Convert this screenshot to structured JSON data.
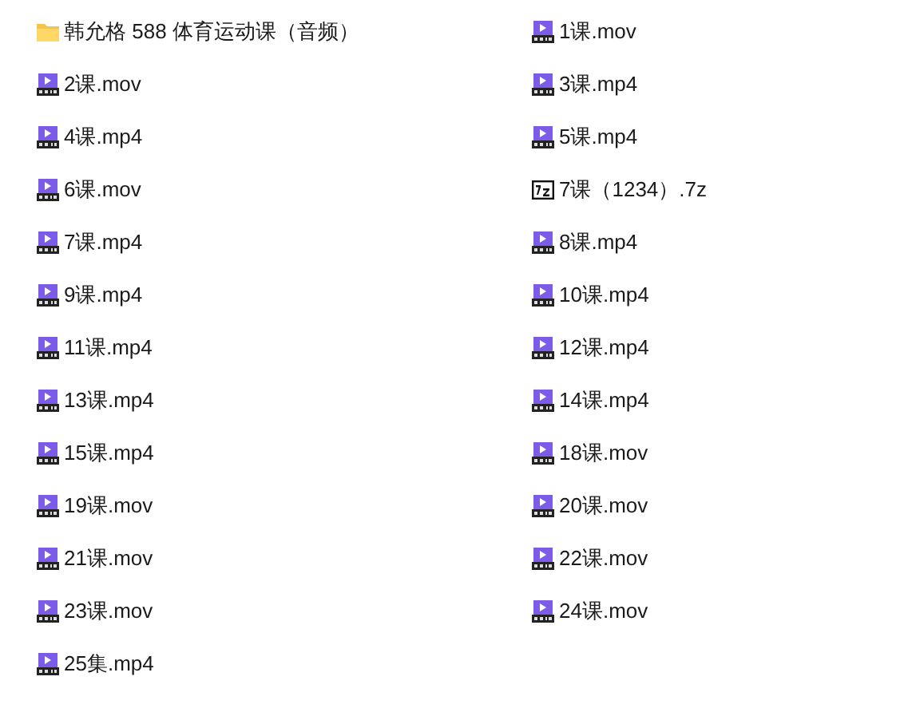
{
  "files": [
    {
      "name": "韩允格 588 体育运动课（音频）",
      "kind": "folder"
    },
    {
      "name": "1课.mov",
      "kind": "mov"
    },
    {
      "name": "2课.mov",
      "kind": "mov"
    },
    {
      "name": "3课.mp4",
      "kind": "mp4"
    },
    {
      "name": "4课.mp4",
      "kind": "mp4"
    },
    {
      "name": "5课.mp4",
      "kind": "mp4"
    },
    {
      "name": "6课.mov",
      "kind": "mov"
    },
    {
      "name": "7课（1234）.7z",
      "kind": "archive"
    },
    {
      "name": "7课.mp4",
      "kind": "mp4"
    },
    {
      "name": "8课.mp4",
      "kind": "mp4"
    },
    {
      "name": "9课.mp4",
      "kind": "mp4"
    },
    {
      "name": "10课.mp4",
      "kind": "mp4"
    },
    {
      "name": "11课.mp4",
      "kind": "mp4"
    },
    {
      "name": "12课.mp4",
      "kind": "mp4"
    },
    {
      "name": "13课.mp4",
      "kind": "mp4"
    },
    {
      "name": "14课.mp4",
      "kind": "mp4"
    },
    {
      "name": "15课.mp4",
      "kind": "mp4"
    },
    {
      "name": "18课.mov",
      "kind": "mov"
    },
    {
      "name": "19课.mov",
      "kind": "mov"
    },
    {
      "name": "20课.mov",
      "kind": "mov"
    },
    {
      "name": "21课.mov",
      "kind": "mov"
    },
    {
      "name": "22课.mov",
      "kind": "mov"
    },
    {
      "name": "23课.mov",
      "kind": "mov"
    },
    {
      "name": "24课.mov",
      "kind": "mov"
    },
    {
      "name": "25集.mp4",
      "kind": "mp4"
    }
  ]
}
